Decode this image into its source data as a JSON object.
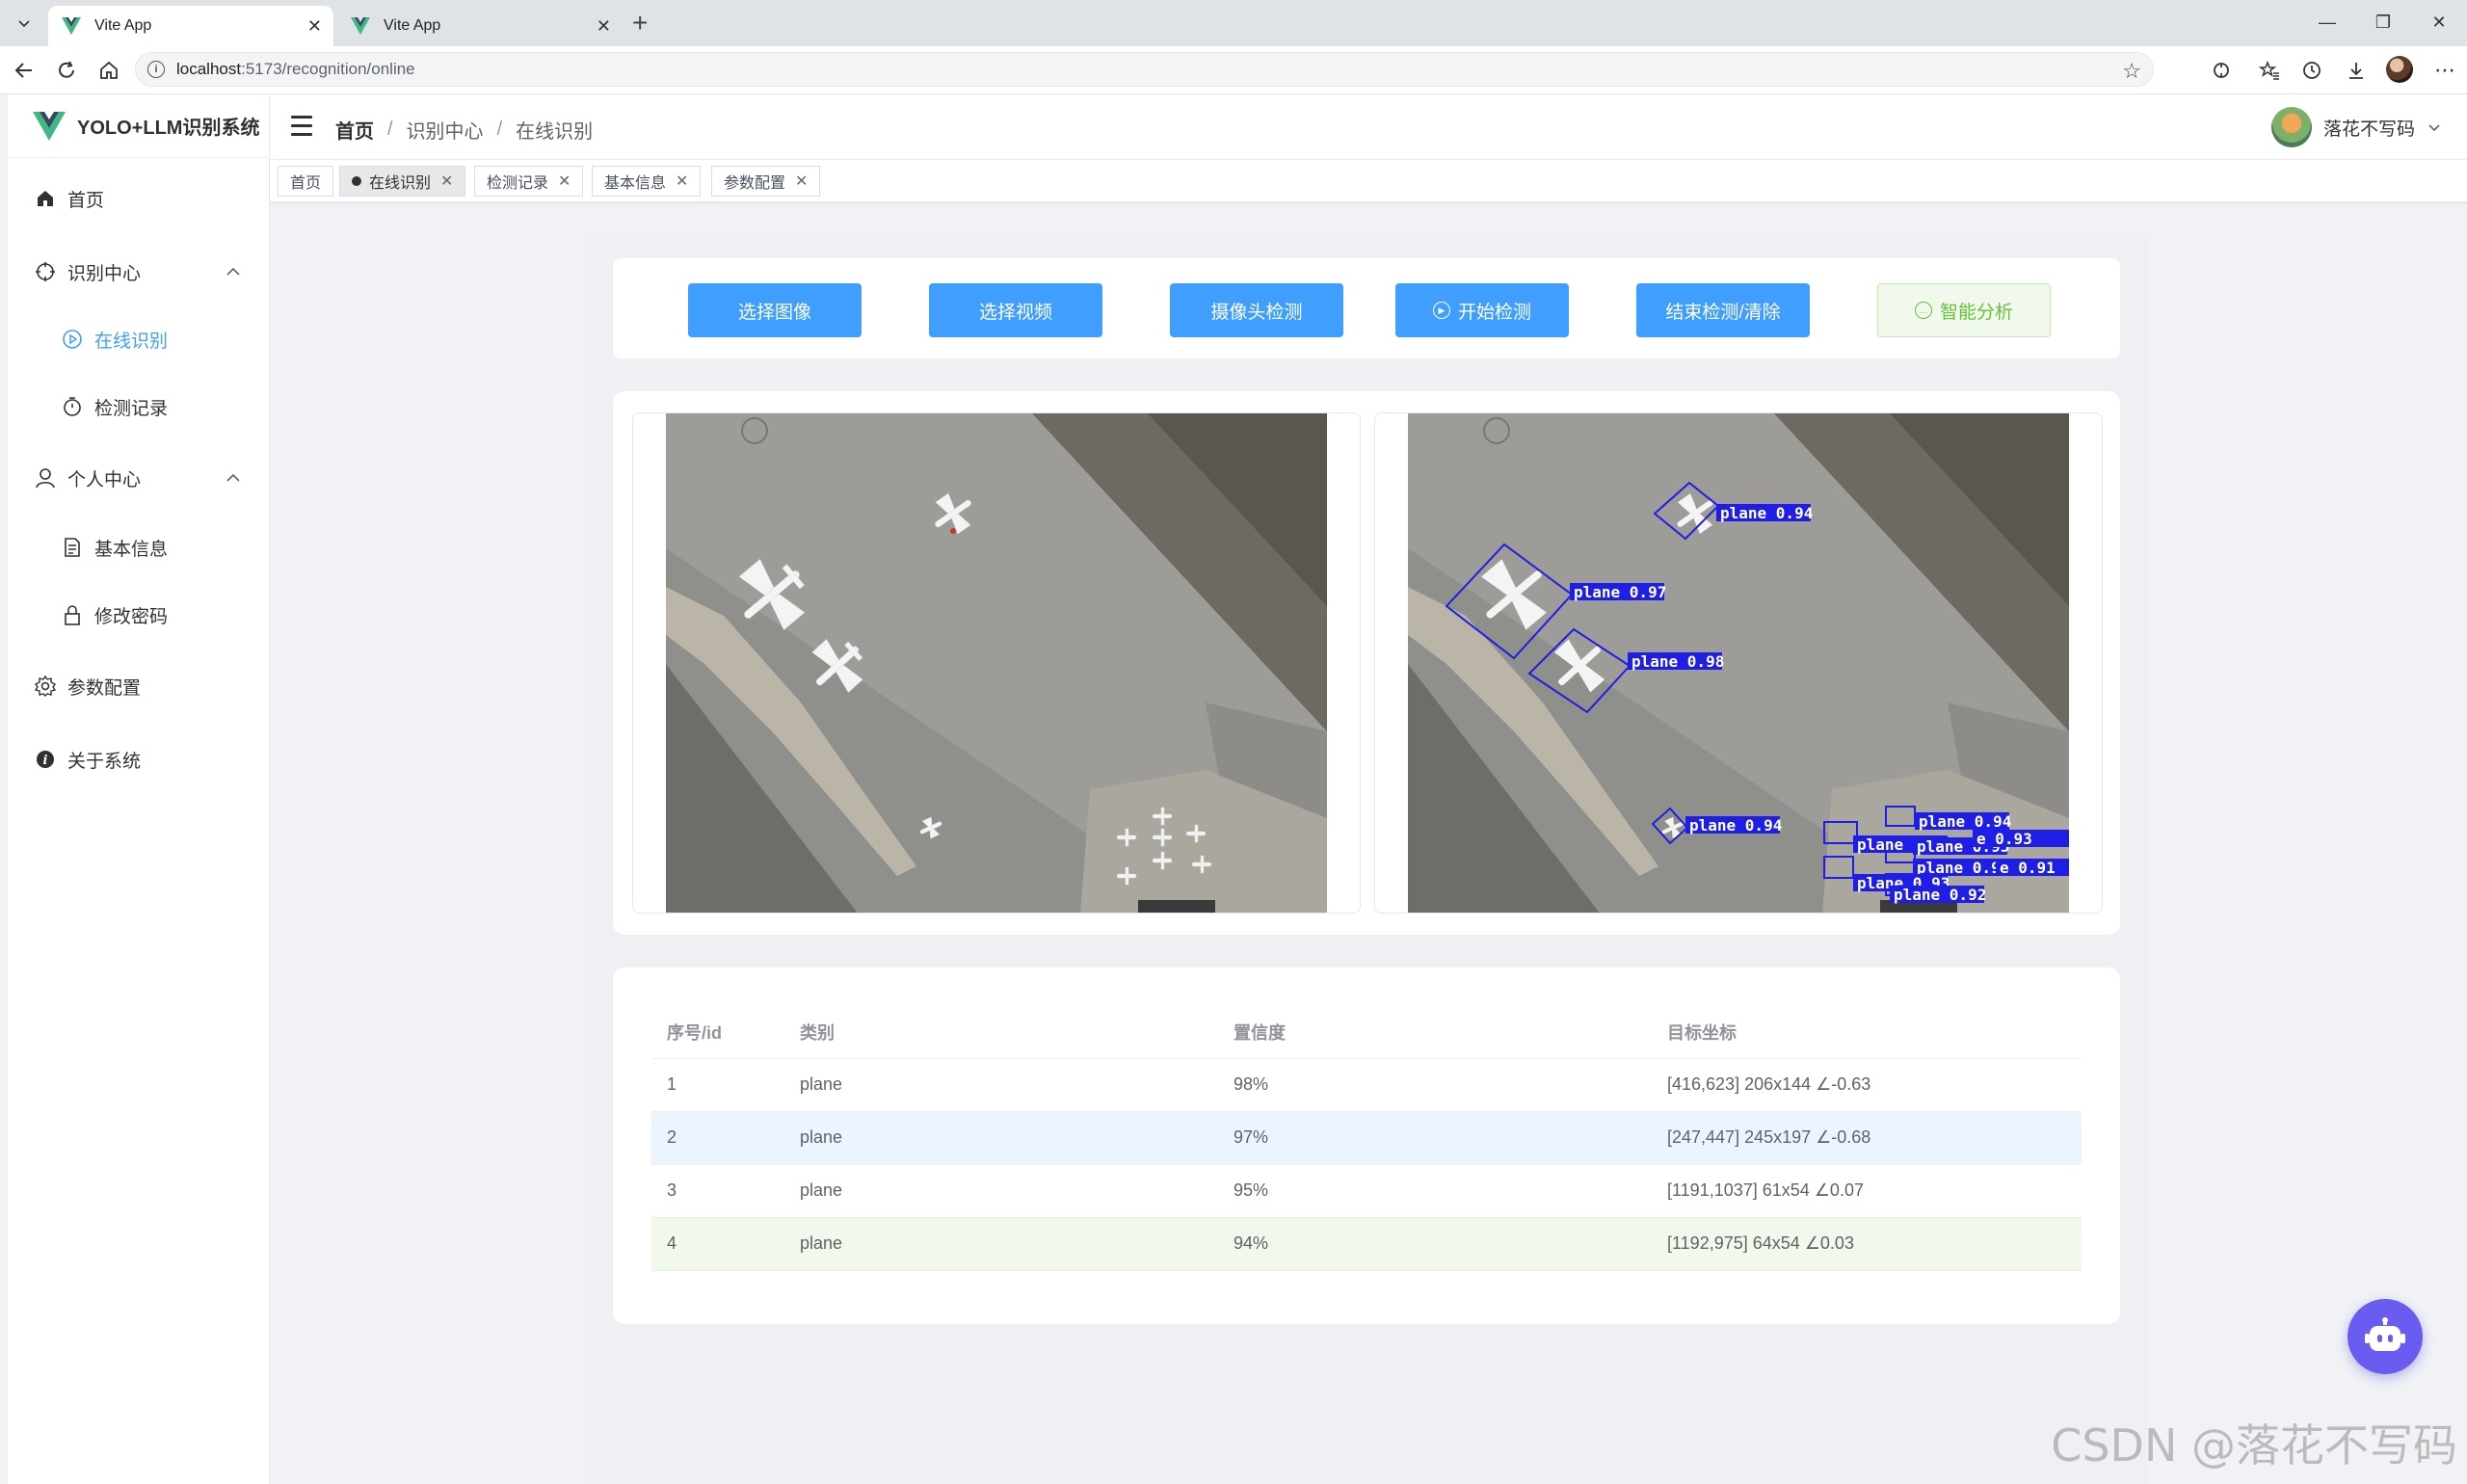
{
  "browser": {
    "tabs": [
      {
        "title": "Vite App",
        "active": true
      },
      {
        "title": "Vite App",
        "active": false
      }
    ],
    "url_host": "localhost",
    "url_path": ":5173/recognition/online"
  },
  "app": {
    "logo_text": "YOLO+LLM识别系统",
    "breadcrumb": [
      "首页",
      "识别中心",
      "在线识别"
    ],
    "user_name": "落花不写码"
  },
  "sidebar": {
    "items": [
      {
        "label": "首页",
        "icon": "home-icon"
      },
      {
        "label": "识别中心",
        "icon": "crosshair-icon",
        "expanded": true
      },
      {
        "label": "在线识别",
        "icon": "play-circle-icon",
        "active": true
      },
      {
        "label": "检测记录",
        "icon": "stopwatch-icon"
      },
      {
        "label": "个人中心",
        "icon": "user-icon",
        "expanded": true
      },
      {
        "label": "基本信息",
        "icon": "document-icon"
      },
      {
        "label": "修改密码",
        "icon": "lock-icon"
      },
      {
        "label": "参数配置",
        "icon": "gear-icon"
      },
      {
        "label": "关于系统",
        "icon": "info-icon"
      }
    ]
  },
  "tags": [
    {
      "label": "首页",
      "closable": false,
      "active": false
    },
    {
      "label": "在线识别",
      "closable": true,
      "active": true
    },
    {
      "label": "检测记录",
      "closable": true,
      "active": false
    },
    {
      "label": "基本信息",
      "closable": true,
      "active": false
    },
    {
      "label": "参数配置",
      "closable": true,
      "active": false
    }
  ],
  "actions": [
    {
      "label": "选择图像"
    },
    {
      "label": "选择视频"
    },
    {
      "label": "摄像头检测"
    },
    {
      "label": "开始检测",
      "icon": "play-circle-icon"
    },
    {
      "label": "结束检测/清除"
    },
    {
      "label": "智能分析",
      "icon": "chat-icon"
    }
  ],
  "detections_overlay": [
    "plane 0.94",
    "plane 0.97",
    "plane 0.98",
    "plane 0.94",
    "plane 0.94",
    "plane 0.95",
    "plane 0.93",
    "plane 0.93",
    "plane 0.94",
    "plane 0.91",
    "plane 0.92"
  ],
  "table": {
    "headers": [
      "序号/id",
      "类别",
      "置信度",
      "目标坐标"
    ],
    "rows": [
      [
        "1",
        "plane",
        "98%",
        "[416,623] 206x144 ∠-0.63"
      ],
      [
        "2",
        "plane",
        "97%",
        "[247,447] 245x197 ∠-0.68"
      ],
      [
        "3",
        "plane",
        "95%",
        "[1191,1037] 61x54 ∠0.07"
      ],
      [
        "4",
        "plane",
        "94%",
        "[1192,975] 64x54 ∠0.03"
      ]
    ]
  },
  "watermark": "CSDN @落花不写码",
  "colors": {
    "primary": "#409eff",
    "success": "#67c23a",
    "robot": "#6a5cf0",
    "box": "#1e1ee6"
  }
}
